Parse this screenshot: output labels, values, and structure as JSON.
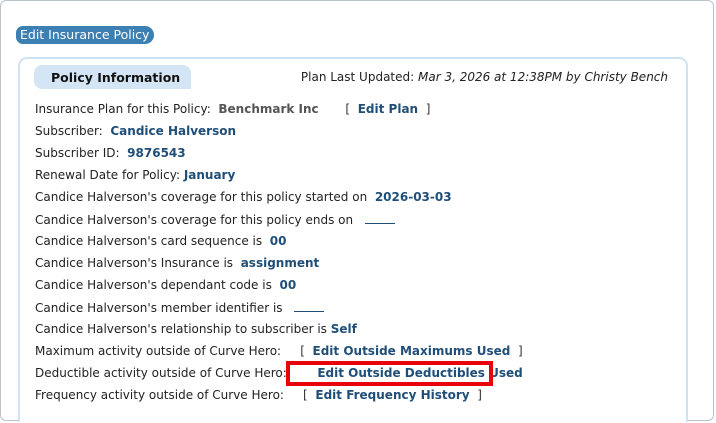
{
  "page": {
    "title": "Edit Insurance Policy"
  },
  "panel": {
    "tab_label": "Policy Information",
    "updated_prefix": "Plan Last Updated: ",
    "updated_value": "Mar 3, 2026 at 12:38PM by Christy Bench"
  },
  "fields": {
    "plan_label": "Insurance Plan for this Policy:",
    "plan_value": "Benchmark Inc",
    "edit_plan": "Edit Plan",
    "subscriber_label": "Subscriber:",
    "subscriber_value": "Candice Halverson",
    "subscriber_id_label": "Subscriber ID:",
    "subscriber_id_value": "9876543",
    "renewal_label": "Renewal Date for Policy:",
    "renewal_value": "January",
    "coverage_start_label": "Candice Halverson's coverage for this policy started on",
    "coverage_start_value": "2026-03-03",
    "coverage_end_label": "Candice Halverson's coverage for this policy ends on",
    "card_seq_label": "Candice Halverson's card sequence is",
    "card_seq_value": "00",
    "insurance_label": "Candice Halverson's Insurance is",
    "insurance_value": "assignment",
    "dependant_label": "Candice Halverson's dependant code is",
    "dependant_value": "00",
    "member_label": "Candice Halverson's member identifier is",
    "relationship_label": "Candice Halverson's relationship to subscriber is",
    "relationship_value": "Self",
    "max_label": "Maximum activity outside of Curve Hero:",
    "max_link": "Edit Outside Maximums Used",
    "deductible_label": "Deductible activity outside of Curve Hero:",
    "deductible_link": "Edit Outside Deductibles Used",
    "frequency_label": "Frequency activity outside of Curve Hero:",
    "frequency_link": "Edit Frequency History"
  },
  "brackets": {
    "open": "[",
    "close": "]"
  },
  "colors": {
    "accent": "#3b7fb3",
    "link": "#1f4e79",
    "highlight": "#e8000b",
    "tab": "#d4e6f6"
  }
}
